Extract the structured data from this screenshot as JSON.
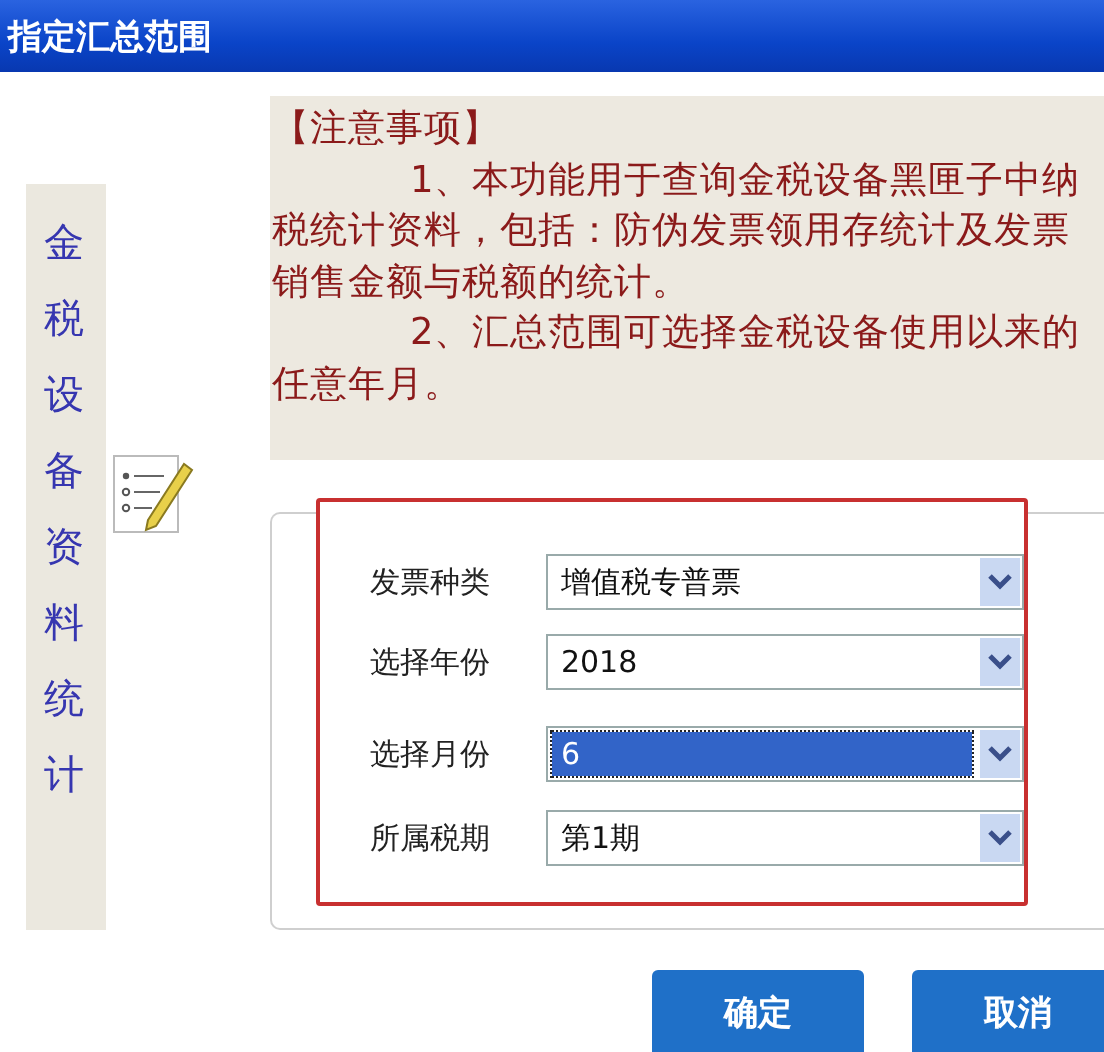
{
  "window": {
    "title": "指定汇总范围"
  },
  "sidebar": {
    "label": "金税设备资料统计"
  },
  "notice": {
    "heading": "【注意事项】",
    "paragraphs": [
      [
        "1、本功能用于查询金税设备黑匣子中纳",
        "税统计资料，包括：防伪发票领用存统计及发票",
        "销售金额与税额的统计。"
      ],
      [
        "2、汇总范围可选择金税设备使用以来的",
        "任意年月。"
      ]
    ]
  },
  "fields": [
    {
      "label": "发票种类",
      "value": "增值税专普票",
      "focused": false
    },
    {
      "label": "选择年份",
      "value": "2018",
      "focused": false
    },
    {
      "label": "选择月份",
      "value": "6",
      "focused": true
    },
    {
      "label": "所属税期",
      "value": "第1期",
      "focused": false
    }
  ],
  "buttons": [
    {
      "label": "确定"
    },
    {
      "label": "取消"
    }
  ]
}
